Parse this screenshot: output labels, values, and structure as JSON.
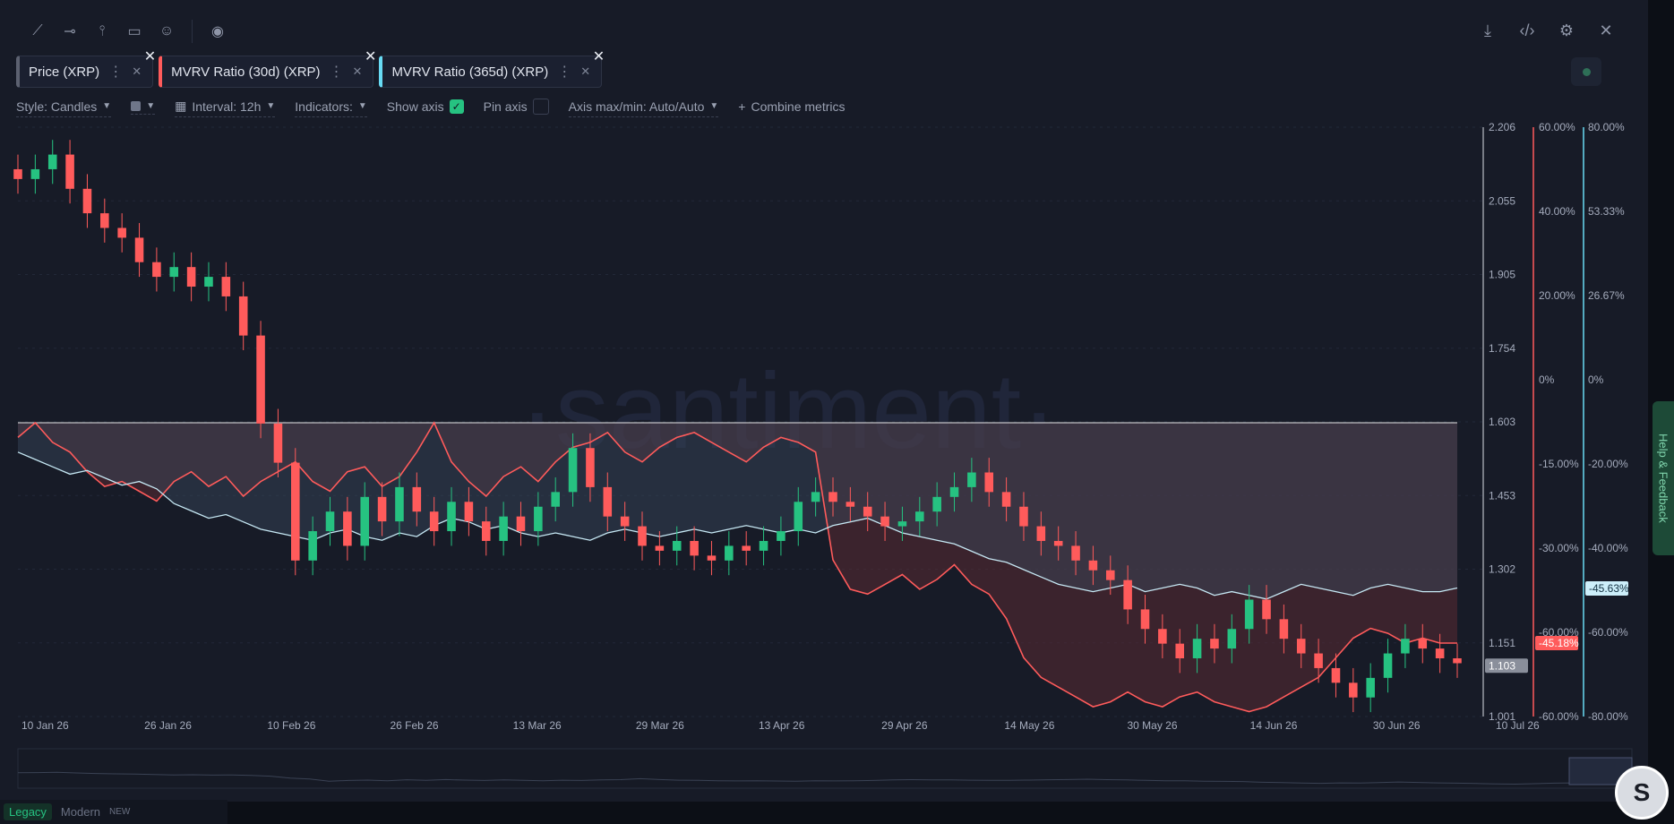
{
  "toolbar": {
    "left_icons": [
      "line-tool-icon",
      "horizontal-ray-icon",
      "vertical-line-icon",
      "note-icon",
      "emoji-icon",
      "eye-icon"
    ],
    "right_icons": [
      "download-icon",
      "embed-code-icon",
      "settings-icon",
      "close-icon"
    ]
  },
  "tabs": [
    {
      "label": "Price (XRP)",
      "color": "#5c6170"
    },
    {
      "label": "MVRV Ratio (30d) (XRP)",
      "color": "#ff5b5b"
    },
    {
      "label": "MVRV Ratio (365d) (XRP)",
      "color": "#68dbf4"
    }
  ],
  "controls": {
    "style": "Style: Candles",
    "interval": "Interval: 12h",
    "indicators": "Indicators:",
    "show_axis": "Show axis",
    "show_axis_checked": true,
    "pin_axis": "Pin axis",
    "pin_axis_checked": false,
    "axis_maxmin": "Axis max/min: Auto/Auto",
    "combine": "Combine metrics"
  },
  "watermark": "·santiment·",
  "colors": {
    "up": "#26c281",
    "down": "#ff5b5b",
    "mvrv30": "#ff5b5b",
    "mvrv365": "#68dbf4",
    "background": "#171b27"
  },
  "chart_data": {
    "type": "candlestick+line",
    "x_ticks": [
      "10 Jan 26",
      "26 Jan 26",
      "10 Feb 26",
      "26 Feb 26",
      "13 Mar 26",
      "29 Mar 26",
      "13 Apr 26",
      "29 Apr 26",
      "14 May 26",
      "30 May 26",
      "14 Jun 26",
      "30 Jun 26",
      "10 Jul 26"
    ],
    "price_axis": [
      "2.206",
      "2.055",
      "1.905",
      "1.754",
      "1.603",
      "1.453",
      "1.302",
      "1.151",
      "1.001"
    ],
    "mvrv30_axis": [
      "60.00%",
      "40.00%",
      "20.00%",
      "0%",
      "-15.00%",
      "-30.00%",
      "-60.00%",
      "-60.00%"
    ],
    "mvrv365_axis": [
      "80.00%",
      "53.33%",
      "26.67%",
      "0%",
      "-20.00%",
      "-40.00%",
      "-60.00%",
      "-80.00%"
    ],
    "last_price": "1.103",
    "last_mvrv30": "-45.18%",
    "last_mvrv365": "-45.63%",
    "price_series": [
      2.1,
      2.12,
      2.15,
      2.08,
      2.03,
      2.0,
      1.98,
      1.93,
      1.9,
      1.92,
      1.88,
      1.9,
      1.86,
      1.78,
      1.6,
      1.52,
      1.32,
      1.38,
      1.42,
      1.35,
      1.45,
      1.4,
      1.47,
      1.42,
      1.38,
      1.44,
      1.4,
      1.36,
      1.41,
      1.38,
      1.43,
      1.46,
      1.55,
      1.47,
      1.41,
      1.39,
      1.35,
      1.34,
      1.36,
      1.33,
      1.32,
      1.35,
      1.34,
      1.36,
      1.38,
      1.44,
      1.46,
      1.44,
      1.43,
      1.41,
      1.39,
      1.4,
      1.42,
      1.45,
      1.47,
      1.5,
      1.46,
      1.43,
      1.39,
      1.36,
      1.35,
      1.32,
      1.3,
      1.28,
      1.22,
      1.18,
      1.15,
      1.12,
      1.16,
      1.14,
      1.18,
      1.24,
      1.2,
      1.16,
      1.13,
      1.1,
      1.07,
      1.04,
      1.08,
      1.13,
      1.16,
      1.14,
      1.12,
      1.11
    ],
    "mvrv30_series": [
      -3,
      0,
      -4,
      -6,
      -10,
      -13,
      -12,
      -14,
      -16,
      -12,
      -10,
      -13,
      -11,
      -15,
      -12,
      -10,
      -8,
      -12,
      -14,
      -10,
      -9,
      -13,
      -11,
      -6,
      0,
      -8,
      -12,
      -15,
      -11,
      -9,
      -12,
      -8,
      -5,
      -4,
      -2,
      -6,
      -8,
      -5,
      -3,
      -2,
      -4,
      -6,
      -8,
      -5,
      -3,
      -4,
      -6,
      -28,
      -34,
      -35,
      -33,
      -31,
      -34,
      -32,
      -29,
      -33,
      -35,
      -40,
      -48,
      -52,
      -54,
      -56,
      -58,
      -57,
      -55,
      -57,
      -58,
      -56,
      -55,
      -57,
      -58,
      -59,
      -58,
      -56,
      -54,
      -52,
      -48,
      -44,
      -42,
      -43,
      -45,
      -44,
      -45,
      -45
    ],
    "mvrv365_series": [
      -8,
      -10,
      -12,
      -14,
      -13,
      -15,
      -17,
      -16,
      -18,
      -22,
      -24,
      -26,
      -25,
      -27,
      -29,
      -30,
      -31,
      -32,
      -30,
      -29,
      -31,
      -32,
      -30,
      -31,
      -28,
      -26,
      -27,
      -29,
      -28,
      -30,
      -31,
      -30,
      -31,
      -32,
      -30,
      -29,
      -30,
      -31,
      -30,
      -29,
      -30,
      -29,
      -28,
      -29,
      -30,
      -29,
      -30,
      -28,
      -27,
      -26,
      -28,
      -30,
      -31,
      -32,
      -33,
      -35,
      -37,
      -38,
      -40,
      -42,
      -44,
      -45,
      -46,
      -45,
      -44,
      -46,
      -45,
      -44,
      -45,
      -47,
      -46,
      -47,
      -48,
      -46,
      -44,
      -45,
      -46,
      -47,
      -45,
      -44,
      -45,
      -46,
      -46,
      -45
    ]
  },
  "footer": {
    "legacy": "Legacy",
    "modern": "Modern",
    "new_badge": "NEW"
  },
  "feedback": "Help & Feedback",
  "chat_letter": "S"
}
